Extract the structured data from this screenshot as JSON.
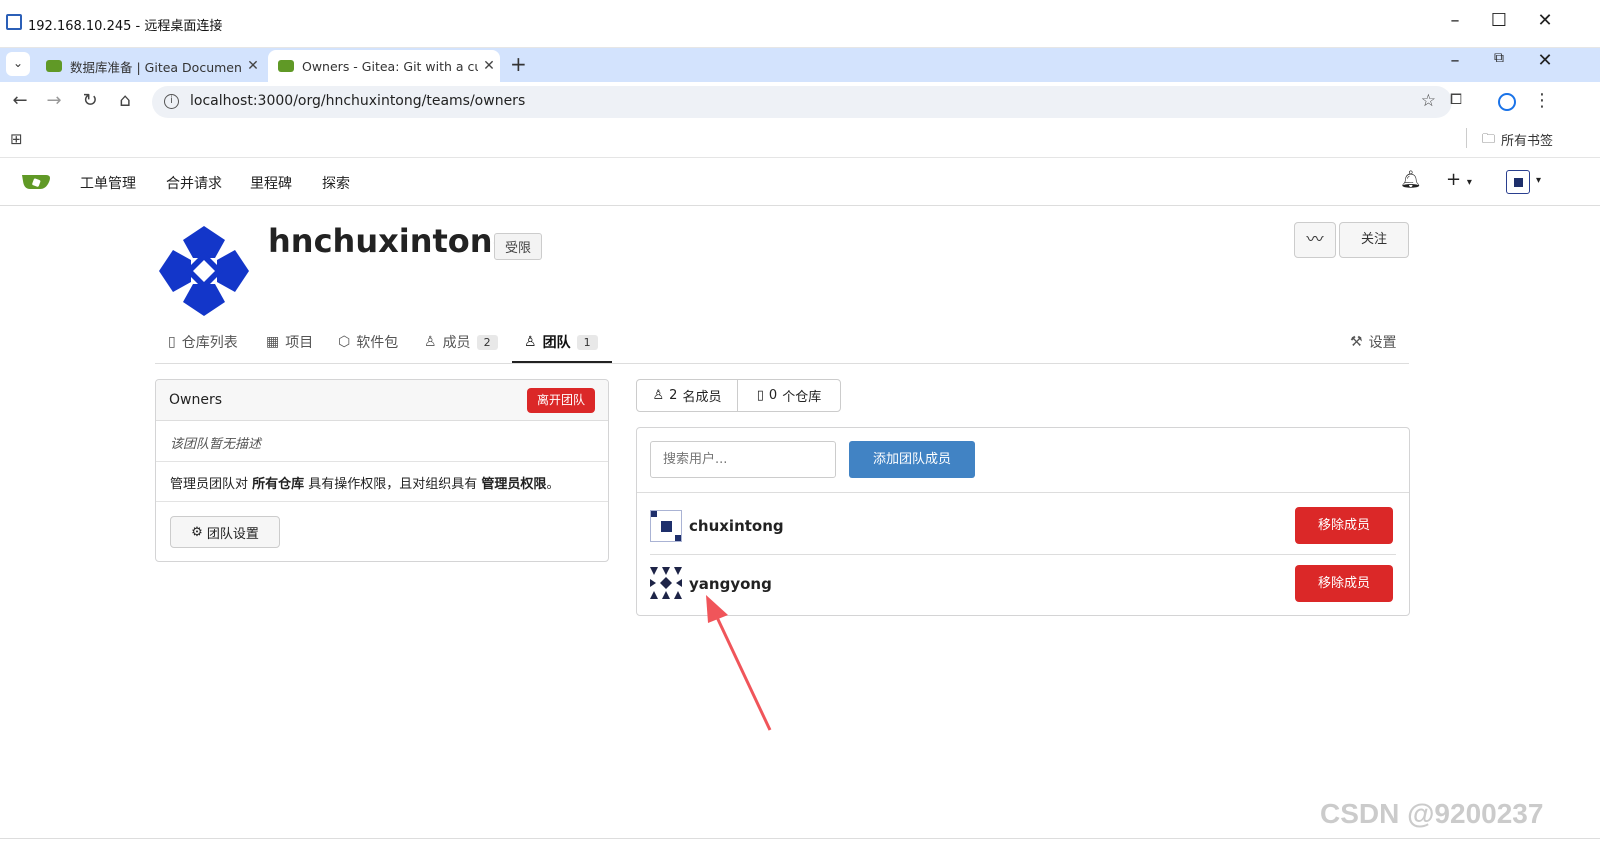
{
  "rdp": {
    "title": "192.168.10.245 - 远程桌面连接"
  },
  "browser": {
    "tabs": [
      {
        "title": "数据库准备 | Gitea Documentation"
      },
      {
        "title": "Owners - Gitea: Git with a cup of tea"
      }
    ],
    "url": "localhost:3000/org/hnchuxintong/teams/owners",
    "bookmarks_label": "所有书签"
  },
  "gitea_nav": {
    "items": [
      "工单管理",
      "合并请求",
      "里程碑",
      "探索"
    ]
  },
  "org": {
    "name": "hnchuxintong",
    "visibility_badge": "受限",
    "follow_label": "关注",
    "tabs": [
      {
        "label": "仓库列表"
      },
      {
        "label": "项目"
      },
      {
        "label": "软件包"
      },
      {
        "label": "成员",
        "count": "2"
      },
      {
        "label": "团队",
        "count": "1"
      }
    ],
    "settings_label": "设置"
  },
  "team": {
    "name": "Owners",
    "leave_label": "离开团队",
    "no_description": "该团队暂无描述",
    "permission_prefix": "管理员团队对 ",
    "permission_all_repos": "所有仓库",
    "permission_mid": " 具有操作权限，且对组织具有 ",
    "permission_admin": "管理员权限",
    "permission_end": "。",
    "settings_label": "团队设置",
    "member_count": "2",
    "member_count_label": "名成员",
    "repo_count": "0",
    "repo_count_label": "个仓库",
    "search_placeholder": "搜索用户...",
    "add_member_label": "添加团队成员",
    "members": [
      {
        "name": "chuxintong",
        "remove_label": "移除成员"
      },
      {
        "name": "yangyong",
        "remove_label": "移除成员"
      }
    ]
  },
  "watermark": "CSDN @9200237",
  "colors": {
    "gitea_green": "#609926",
    "danger": "#db2828",
    "primary": "#4183c4",
    "annotation_arrow": "#f0555a"
  }
}
